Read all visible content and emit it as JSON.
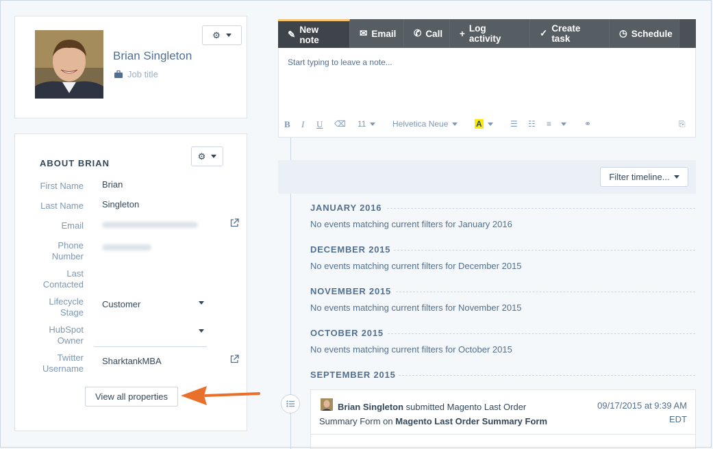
{
  "profile": {
    "name": "Brian Singleton",
    "job_title_placeholder": "Job title"
  },
  "about": {
    "title": "ABOUT BRIAN",
    "properties": [
      {
        "label": "First Name",
        "value": "Brian"
      },
      {
        "label": "Last Name",
        "value": "Singleton"
      },
      {
        "label": "Email",
        "value": ""
      },
      {
        "label": "Phone Number",
        "value": ""
      },
      {
        "label": "Last Contacted",
        "value": ""
      },
      {
        "label": "Lifecycle Stage",
        "value": "Customer"
      },
      {
        "label": "HubSpot Owner",
        "value": ""
      },
      {
        "label": "Twitter Username",
        "value": "SharktankMBA"
      }
    ],
    "view_all_label": "View all properties"
  },
  "composer": {
    "tabs": [
      {
        "label": "New note",
        "icon": "pencil-icon"
      },
      {
        "label": "Email",
        "icon": "envelope-icon"
      },
      {
        "label": "Call",
        "icon": "phone-icon"
      },
      {
        "label": "Log activity",
        "icon": "plus-icon"
      },
      {
        "label": "Create task",
        "icon": "check-circle-icon"
      },
      {
        "label": "Schedule",
        "icon": "clock-icon"
      }
    ],
    "placeholder": "Start typing to leave a note...",
    "toolbar": {
      "font_size": "11",
      "font_family": "Helvetica Neue"
    }
  },
  "timeline": {
    "filter_label": "Filter timeline...",
    "months": [
      {
        "label": "JANUARY 2016",
        "message": "No events matching current filters for January 2016"
      },
      {
        "label": "DECEMBER 2015",
        "message": "No events matching current filters for December 2015"
      },
      {
        "label": "NOVEMBER 2015",
        "message": "No events matching current filters for November 2015"
      },
      {
        "label": "OCTOBER 2015",
        "message": "No events matching current filters for October 2015"
      },
      {
        "label": "SEPTEMBER 2015",
        "message": ""
      }
    ],
    "event": {
      "actor": "Brian Singleton",
      "verb": " submitted Magento Last Order Summary Form on ",
      "target": "Magento Last Order Summary Form",
      "date": "09/17/2015 at 9:39 AM",
      "tz": "EDT"
    }
  },
  "colors": {
    "arrow": "#e8702a",
    "active_tab_accent": "#f5c26b",
    "tab_bar": "#4b5157"
  }
}
